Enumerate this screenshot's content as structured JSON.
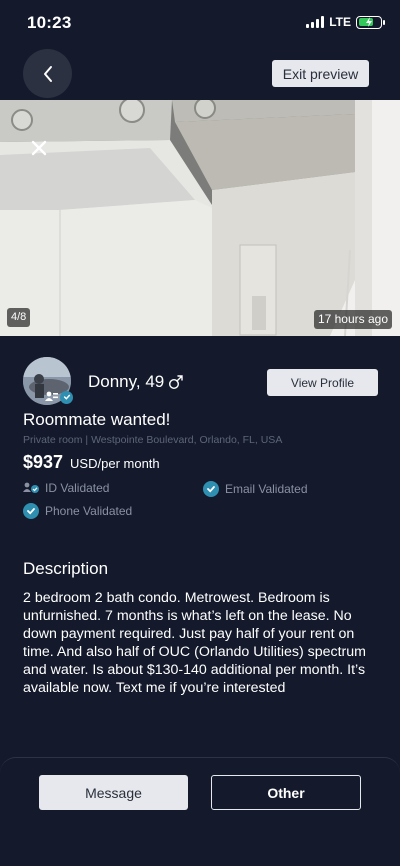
{
  "status_bar": {
    "time": "10:23",
    "network": "LTE"
  },
  "header": {
    "back_icon": "chevron-left-icon",
    "exit_label": "Exit preview"
  },
  "photo": {
    "counter": "4/8",
    "age": "17 hours ago",
    "close_icon": "close-icon"
  },
  "profile": {
    "name": "Donny, 49",
    "gender_icon": "male-symbol-icon",
    "view_profile_label": "View Profile"
  },
  "listing": {
    "title": "Roommate wanted!",
    "location": "Private room | Westpointe Boulevard, Orlando, FL, USA",
    "price": "$937",
    "price_unit": "USD/per month"
  },
  "validations": {
    "id": "ID Validated",
    "email": "Email Validated",
    "phone": "Phone Validated"
  },
  "description": {
    "heading": "Description",
    "body": "2 bedroom 2 bath condo. Metrowest. Bedroom is unfurnished. 7 months is what’s left on the lease. No down payment required. Just pay half of your rent on time. And also half of OUC (Orlando Utilities) spectrum and water. Is about $130-140 additional per month. It’s available now. Text me if you’re interested"
  },
  "footer": {
    "message_label": "Message",
    "other_label": "Other"
  },
  "colors": {
    "background": "#141a2c",
    "button_light": "#e6e8ee",
    "check_blue": "#2f8fb1",
    "muted_text": "#8a91a2"
  }
}
